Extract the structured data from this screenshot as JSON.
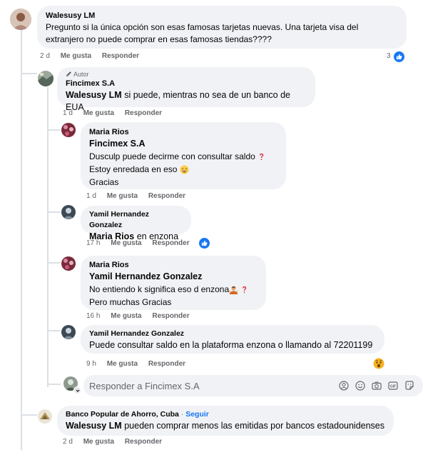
{
  "comments": [
    {
      "author": "Walesusy LM",
      "text": "Pregunto si la única opción son esas famosas tarjetas nuevas. Una tarjeta visa del extranjero no puede comprar en esas famosas tiendas????",
      "time": "2 d",
      "like": "Me gusta",
      "reply": "Responder",
      "reactions": "3"
    },
    {
      "badge": "Autor",
      "author": "Fincimex S.A",
      "mention": "Walesusy LM",
      "text": " si puede, mientras no sea de un banco de EUA",
      "time": "1 d",
      "like": "Me gusta",
      "reply": "Responder"
    },
    {
      "author": "Maria Rios",
      "mention": "Fincimex S.A",
      "lines": [
        "Dusculp puede decirme con consultar saldo",
        "Estoy enredada en eso",
        "Gracias"
      ],
      "time": "1 d",
      "like": "Me gusta",
      "reply": "Responder"
    },
    {
      "author": "Yamil Hernandez Gonzalez",
      "mention": "Maria Rios",
      "text": " en enzona",
      "time": "17 h",
      "like": "Me gusta",
      "reply": "Responder"
    },
    {
      "author": "Maria Rios",
      "mention": "Yamil Hernandez Gonzalez",
      "lines": [
        "No entiendo k significa eso d enzona",
        "Pero muchas Gracias"
      ],
      "time": "16 h",
      "like": "Me gusta",
      "reply": "Responder"
    },
    {
      "author": "Yamil Hernandez Gonzalez",
      "text": "Puede consultar saldo en la plataforma enzona o llamando al 72201199",
      "time": "9 h",
      "like": "Me gusta",
      "reply": "Responder"
    },
    {
      "author": "Banco Popular de Ahorro, Cuba",
      "follow": "Seguir",
      "mention": "Walesusy LM",
      "text": " pueden comprar menos las emitidas por bancos estadounidenses",
      "time": "2 d",
      "like": "Me gusta",
      "reply": "Responder"
    }
  ],
  "reply_box": {
    "placeholder": "Responder a Fincimex S.A"
  },
  "colors": {
    "link": "#1877f2",
    "muted": "#65676b",
    "bubble": "#f0f2f5"
  },
  "icons": [
    "like-icon",
    "pencil-icon",
    "question-icon",
    "grin-icon",
    "shrug-icon",
    "wow-icon",
    "avatar-icon",
    "sticker-icon",
    "emoji-icon",
    "camera-icon",
    "gif-icon"
  ]
}
